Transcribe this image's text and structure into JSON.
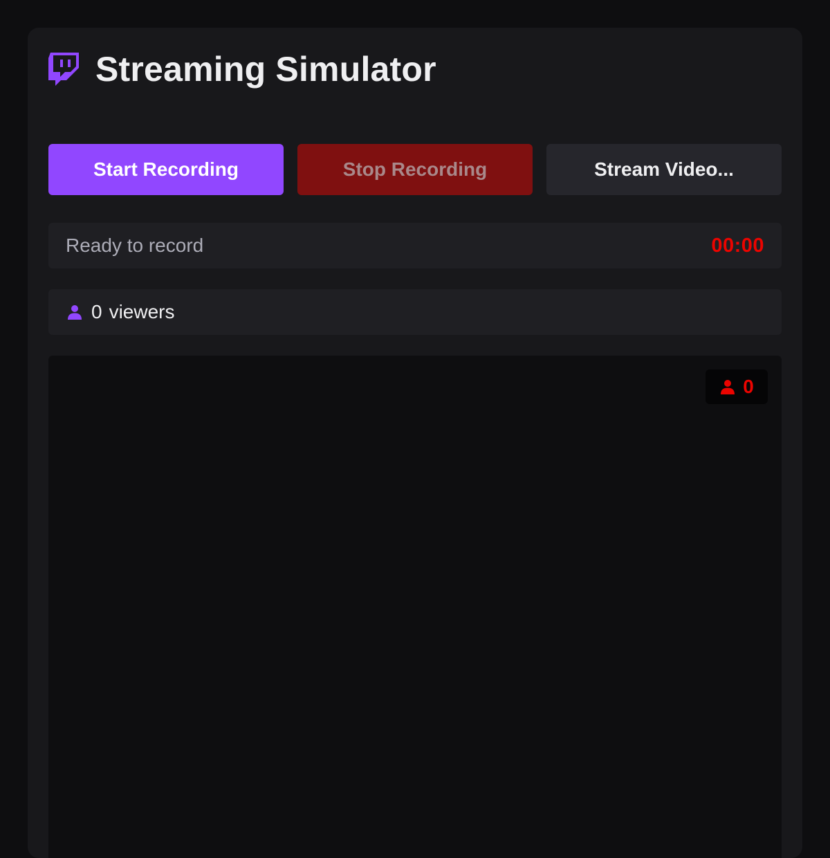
{
  "app": {
    "title": "Streaming Simulator",
    "logo_icon": "twitch-logo-icon"
  },
  "controls": {
    "start_label": "Start Recording",
    "stop_label": "Stop Recording",
    "stream_label": "Stream Video..."
  },
  "status": {
    "text": "Ready to record",
    "timer": "00:00"
  },
  "viewers": {
    "count": "0",
    "label": "viewers",
    "icon": "user-icon"
  },
  "video": {
    "badge_count": "0",
    "badge_icon": "user-icon"
  },
  "colors": {
    "accent": "#9147ff",
    "stop": "#7f1010",
    "live_red": "#eb0400",
    "background": "#0e0e10",
    "panel": "#18181b"
  }
}
